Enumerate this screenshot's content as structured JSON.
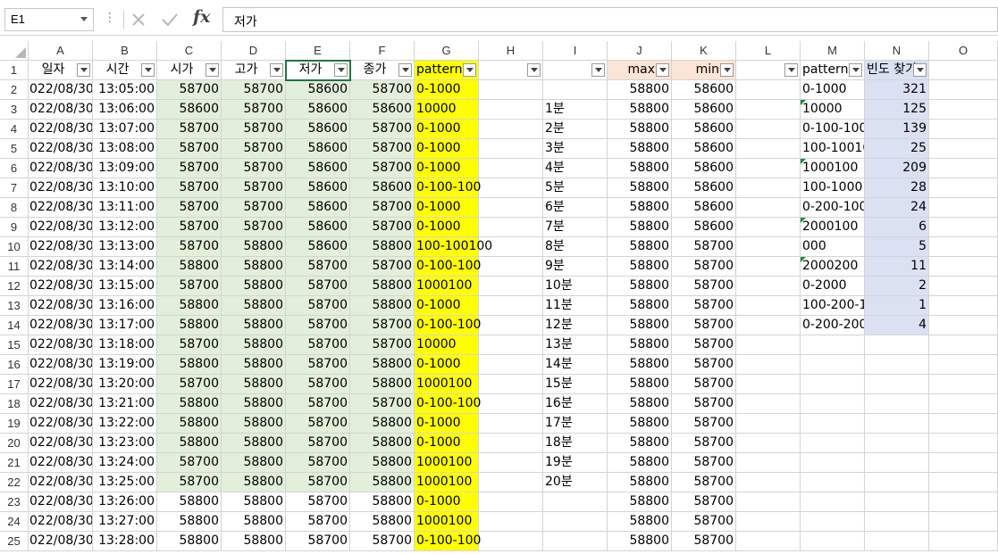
{
  "formula_bar": {
    "name_box": "E1",
    "formula": "저가",
    "cancel_label": "✕",
    "enter_label": "✓",
    "fx_label": "fx"
  },
  "columns": [
    "A",
    "B",
    "C",
    "D",
    "E",
    "F",
    "G",
    "H",
    "I",
    "J",
    "K",
    "L",
    "M",
    "N",
    "O"
  ],
  "header_row": [
    "일자",
    "시간",
    "시가",
    "고가",
    "저가",
    "종가",
    "pattern",
    "",
    "",
    "max",
    "min",
    "",
    "pattern",
    "빈도 찾기",
    ""
  ],
  "rows": [
    [
      "022/08/30",
      "13:05:00",
      "58700",
      "58700",
      "58600",
      "58700",
      "0-1000",
      "",
      "",
      "58800",
      "58600",
      "",
      "0-1000",
      "321",
      ""
    ],
    [
      "022/08/30",
      "13:06:00",
      "58600",
      "58700",
      "58600",
      "58600",
      "10000",
      "",
      "1분",
      "58800",
      "58600",
      "",
      "10000",
      "125",
      ""
    ],
    [
      "022/08/30",
      "13:07:00",
      "58700",
      "58700",
      "58600",
      "58700",
      "0-1000",
      "",
      "2분",
      "58800",
      "58600",
      "",
      "0-100-100",
      "139",
      ""
    ],
    [
      "022/08/30",
      "13:08:00",
      "58700",
      "58700",
      "58600",
      "58700",
      "0-1000",
      "",
      "3분",
      "58800",
      "58600",
      "",
      "100-10010",
      "25",
      ""
    ],
    [
      "022/08/30",
      "13:09:00",
      "58700",
      "58700",
      "58600",
      "58700",
      "0-1000",
      "",
      "4분",
      "58800",
      "58600",
      "",
      "1000100",
      "209",
      ""
    ],
    [
      "022/08/30",
      "13:10:00",
      "58700",
      "58700",
      "58600",
      "58600",
      "0-100-100",
      "",
      "5분",
      "58800",
      "58600",
      "",
      "100-1000",
      "28",
      ""
    ],
    [
      "022/08/30",
      "13:11:00",
      "58700",
      "58700",
      "58600",
      "58700",
      "0-1000",
      "",
      "6분",
      "58800",
      "58600",
      "",
      "0-200-100",
      "24",
      ""
    ],
    [
      "022/08/30",
      "13:12:00",
      "58700",
      "58700",
      "58600",
      "58700",
      "0-1000",
      "",
      "7분",
      "58800",
      "58600",
      "",
      "2000100",
      "6",
      ""
    ],
    [
      "022/08/30",
      "13:13:00",
      "58700",
      "58800",
      "58600",
      "58800",
      "100-100100",
      "",
      "8분",
      "58800",
      "58700",
      "",
      "000",
      "5",
      ""
    ],
    [
      "022/08/30",
      "13:14:00",
      "58800",
      "58800",
      "58700",
      "58700",
      "0-100-100",
      "",
      "9분",
      "58800",
      "58700",
      "",
      "2000200",
      "11",
      ""
    ],
    [
      "022/08/30",
      "13:15:00",
      "58700",
      "58800",
      "58700",
      "58800",
      "1000100",
      "",
      "10분",
      "58800",
      "58700",
      "",
      "0-2000",
      "2",
      ""
    ],
    [
      "022/08/30",
      "13:16:00",
      "58800",
      "58800",
      "58700",
      "58800",
      "0-1000",
      "",
      "11분",
      "58800",
      "58700",
      "",
      "100-200-1",
      "1",
      ""
    ],
    [
      "022/08/30",
      "13:17:00",
      "58800",
      "58800",
      "58700",
      "58700",
      "0-100-100",
      "",
      "12분",
      "58800",
      "58700",
      "",
      "0-200-200",
      "4",
      ""
    ],
    [
      "022/08/30",
      "13:18:00",
      "58700",
      "58800",
      "58700",
      "58700",
      "10000",
      "",
      "13분",
      "58800",
      "58700",
      "",
      "",
      "",
      ""
    ],
    [
      "022/08/30",
      "13:19:00",
      "58800",
      "58800",
      "58700",
      "58800",
      "0-1000",
      "",
      "14분",
      "58800",
      "58700",
      "",
      "",
      "",
      ""
    ],
    [
      "022/08/30",
      "13:20:00",
      "58700",
      "58800",
      "58700",
      "58800",
      "1000100",
      "",
      "15분",
      "58800",
      "58700",
      "",
      "",
      "",
      ""
    ],
    [
      "022/08/30",
      "13:21:00",
      "58800",
      "58800",
      "58700",
      "58700",
      "0-100-100",
      "",
      "16분",
      "58800",
      "58700",
      "",
      "",
      "",
      ""
    ],
    [
      "022/08/30",
      "13:22:00",
      "58800",
      "58800",
      "58700",
      "58800",
      "0-1000",
      "",
      "17분",
      "58800",
      "58700",
      "",
      "",
      "",
      ""
    ],
    [
      "022/08/30",
      "13:23:00",
      "58800",
      "58800",
      "58700",
      "58800",
      "0-1000",
      "",
      "18분",
      "58800",
      "58700",
      "",
      "",
      "",
      ""
    ],
    [
      "022/08/30",
      "13:24:00",
      "58700",
      "58800",
      "58700",
      "58800",
      "1000100",
      "",
      "19분",
      "58800",
      "58700",
      "",
      "",
      "",
      ""
    ],
    [
      "022/08/30",
      "13:25:00",
      "58700",
      "58800",
      "58700",
      "58800",
      "1000100",
      "",
      "20분",
      "58800",
      "58700",
      "",
      "",
      "",
      ""
    ],
    [
      "022/08/30",
      "13:26:00",
      "58800",
      "58800",
      "58700",
      "58800",
      "0-1000",
      "",
      "",
      "58800",
      "58700",
      "",
      "",
      "",
      ""
    ],
    [
      "022/08/30",
      "13:27:00",
      "58800",
      "58800",
      "58700",
      "58800",
      "1000100",
      "",
      "",
      "58800",
      "58700",
      "",
      "",
      "",
      ""
    ],
    [
      "022/08/30",
      "13:28:00",
      "58800",
      "58800",
      "58700",
      "58700",
      "0-100-100",
      "",
      "",
      "58800",
      "58700",
      "",
      "",
      "",
      ""
    ]
  ],
  "colors": {
    "pattern_fill": "#ffff00",
    "price_fill": "#e2efda",
    "maxmin_header_fill": "#fce4d6",
    "freq_fill": "#d9e1f2",
    "selection": "#217346"
  },
  "selected_cell": "E1"
}
